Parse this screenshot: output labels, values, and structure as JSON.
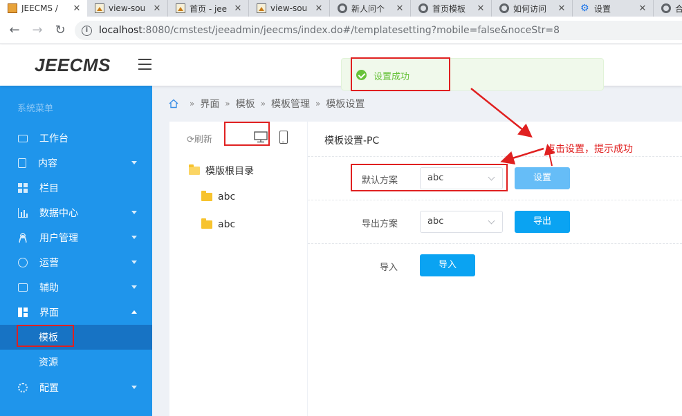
{
  "browser": {
    "tabs": [
      {
        "title": "JEECMS /",
        "icon": "jeecms-favicon",
        "active": true
      },
      {
        "title": "view-sou",
        "icon": "image-favicon"
      },
      {
        "title": "首页 - jee",
        "icon": "image-favicon"
      },
      {
        "title": "view-sou",
        "icon": "image-favicon"
      },
      {
        "title": "新人问个",
        "icon": "globe-favicon"
      },
      {
        "title": "首页模板",
        "icon": "globe-favicon"
      },
      {
        "title": "如何访问",
        "icon": "globe-favicon"
      },
      {
        "title": "设置",
        "icon": "gear-favicon"
      },
      {
        "title": "合",
        "icon": "globe-favicon"
      }
    ],
    "url_host": "localhost",
    "url_rest": ":8080/cmstest/jeeadmin/jeecms/index.do#/templatesetting?mobile=false&noceStr=8"
  },
  "header": {
    "logo": "JEECMS"
  },
  "sidebar": {
    "title": "系统菜单",
    "items": [
      {
        "label": "工作台",
        "icon": "monitor-icon",
        "caret": false
      },
      {
        "label": "内容",
        "icon": "document-icon",
        "caret": true
      },
      {
        "label": "栏目",
        "icon": "grid-icon",
        "caret": false
      },
      {
        "label": "数据中心",
        "icon": "bar-chart-icon",
        "caret": true
      },
      {
        "label": "用户管理",
        "icon": "user-icon",
        "caret": true
      },
      {
        "label": "运营",
        "icon": "shield-icon",
        "caret": true
      },
      {
        "label": "辅助",
        "icon": "toolbox-icon",
        "caret": true
      },
      {
        "label": "界面",
        "icon": "layout-icon",
        "caret": true,
        "expanded": true
      }
    ],
    "sub_items": [
      {
        "label": "模板",
        "active": true
      },
      {
        "label": "资源",
        "active": false
      }
    ],
    "config_item": {
      "label": "配置",
      "icon": "gear-icon",
      "caret": true
    }
  },
  "breadcrumb": [
    "界面",
    "模板",
    "模板管理",
    "模板设置"
  ],
  "tree": {
    "refresh_label": "刷新",
    "root_label": "模版根目录",
    "children": [
      "abc",
      "abc"
    ]
  },
  "form": {
    "title": "模板设置-PC",
    "rows": [
      {
        "label": "默认方案",
        "value": "abc",
        "button": "设置"
      },
      {
        "label": "导出方案",
        "value": "abc",
        "button": "导出"
      },
      {
        "label": "导入",
        "button": "导入"
      }
    ]
  },
  "toast": {
    "message": "设置成功",
    "type": "success"
  },
  "annotation": {
    "text": "点击设置，提示成功",
    "color": "#e02020"
  },
  "colors": {
    "sidebar_bg": "#1f95eb",
    "sidebar_active": "#1773c4",
    "primary_button": "#0aa3f2",
    "disabled_button": "#66bdf7",
    "success": "#67c23a"
  }
}
